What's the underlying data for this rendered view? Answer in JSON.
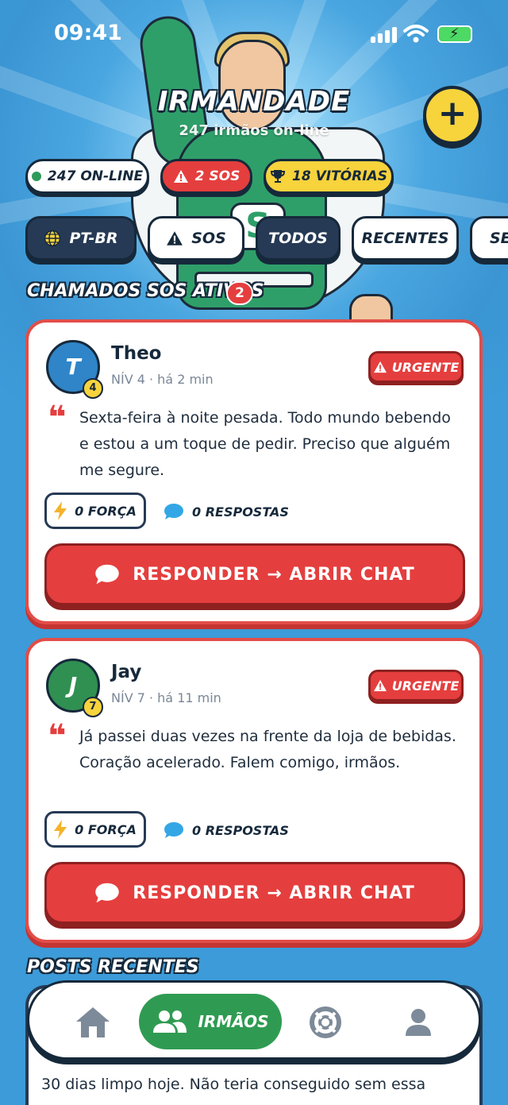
{
  "status_bar": {
    "time": "09:41"
  },
  "header": {
    "title": "IRMANDADE",
    "subtitle": "247 irmãos on-line",
    "add_button_icon": "plus-icon",
    "add_button_label": "+"
  },
  "stats": {
    "online": "247 ON-LINE",
    "sos": "2 SOS",
    "wins": "18 VITÓRIAS"
  },
  "filters": {
    "language": "PT-BR",
    "sos": "SOS",
    "all": "TODOS",
    "recent": "RECENTES",
    "more": "SE"
  },
  "sos_section": {
    "title": "CHAMADOS SOS ATIVOS",
    "count": "2",
    "cards": [
      {
        "initial": "T",
        "level": "4",
        "name": "Theo",
        "meta": "NÍV 4 · há 2 min",
        "badge": "URGENTE",
        "quote": "❝",
        "message": "Sexta-feira à noite pesada. Todo mundo bebendo e estou a um toque de pedir. Preciso que alguém me segure.",
        "force": "0 FORÇA",
        "replies": "0 RESPOSTAS",
        "action": "RESPONDER → ABRIR CHAT"
      },
      {
        "initial": "J",
        "level": "7",
        "name": "Jay",
        "meta": "NÍV 7 · há 11 min",
        "badge": "URGENTE",
        "quote": "❝",
        "message": "Já passei duas vezes na frente da loja de bebidas. Coração acelerado. Falem comigo, irmãos.",
        "force": "0 FORÇA",
        "replies": "0 RESPOSTAS",
        "action": "RESPONDER → ABRIR CHAT"
      }
    ]
  },
  "recent_section": {
    "title": "POSTS RECENTES",
    "preview_text": "30 dias limpo hoje. Não teria conseguido sem essa"
  },
  "bottom_nav": {
    "home_icon": "home-icon",
    "active_label": "IRMÃOS",
    "help_icon": "lifebuoy-icon",
    "profile_icon": "profile-icon"
  },
  "colors": {
    "accent_red": "#e53e3e",
    "accent_yellow": "#f7d33c",
    "accent_green": "#2f9b52",
    "navy": "#16293b",
    "sky": "#3c9bd8"
  }
}
